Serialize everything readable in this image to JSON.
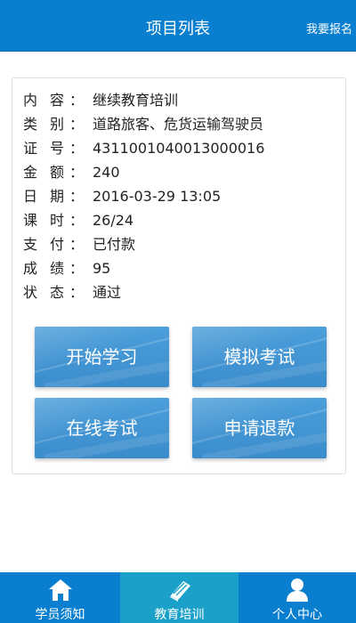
{
  "header": {
    "title": "项目列表",
    "action_label": "我要报名"
  },
  "details": [
    {
      "label1": "内",
      "label2": "容",
      "value": "继续教育培训"
    },
    {
      "label1": "类",
      "label2": "别",
      "value": "道路旅客、危货运输驾驶员"
    },
    {
      "label1": "证",
      "label2": "号",
      "value": "4311001040013000016"
    },
    {
      "label1": "金",
      "label2": "额",
      "value": "240"
    },
    {
      "label1": "日",
      "label2": "期",
      "value": "2016-03-29 13:05"
    },
    {
      "label1": "课",
      "label2": "时",
      "value": "26/24"
    },
    {
      "label1": "支",
      "label2": "付",
      "value": "已付款"
    },
    {
      "label1": "成",
      "label2": "绩",
      "value": "95"
    },
    {
      "label1": "状",
      "label2": "态",
      "value": "通过"
    }
  ],
  "actions": {
    "start_study": "开始学习",
    "mock_exam": "模拟考试",
    "online_exam": "在线考试",
    "refund": "申请退款"
  },
  "tabs": [
    {
      "label": "学员须知",
      "icon": "home-icon",
      "active": false
    },
    {
      "label": "教育培训",
      "icon": "book-icon",
      "active": true
    },
    {
      "label": "个人中心",
      "icon": "person-icon",
      "active": false
    }
  ],
  "colors": {
    "header": "#0a7fd0",
    "tab_active": "#1ba1c9",
    "button": "#3b8ccc"
  }
}
